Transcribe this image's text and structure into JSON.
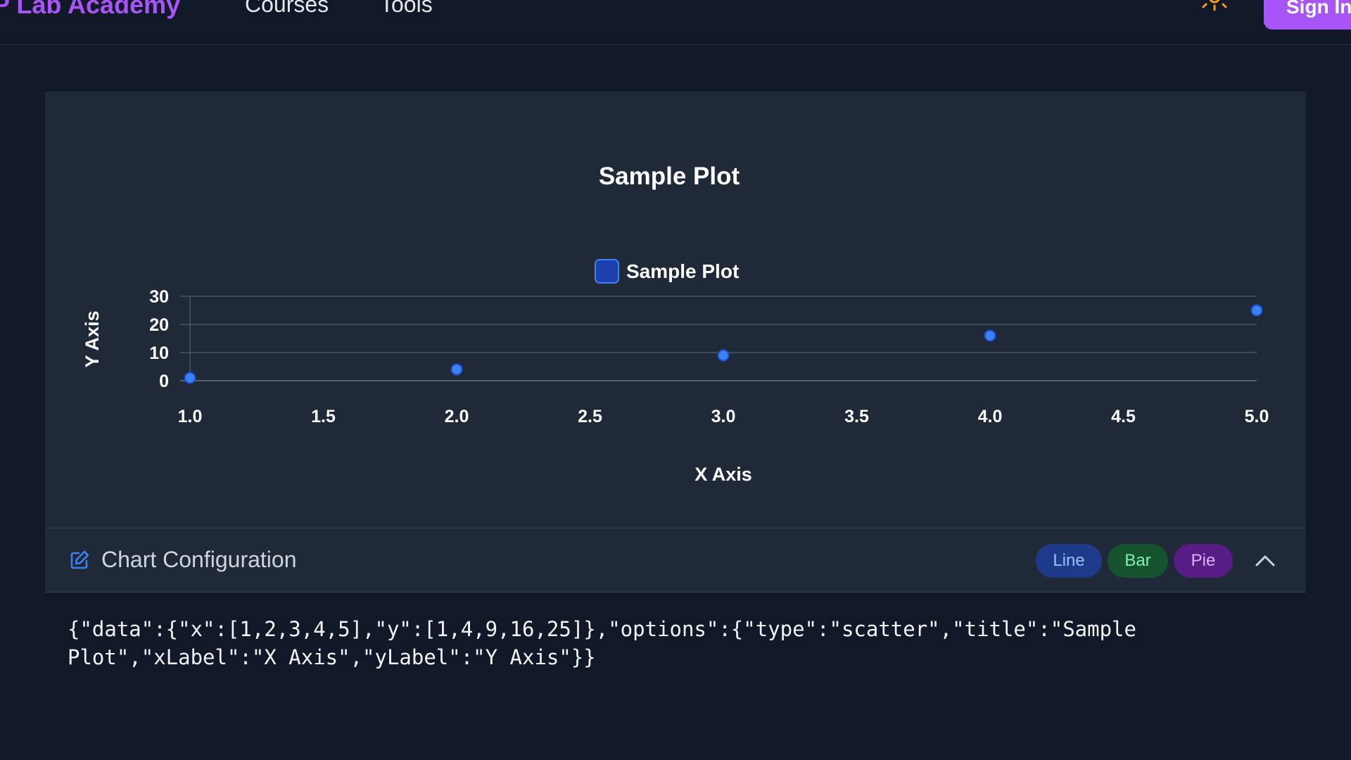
{
  "header": {
    "brand": "P Lab Academy",
    "nav": [
      {
        "label": "Courses"
      },
      {
        "label": "Tools"
      }
    ],
    "theme_icon": "sun-icon",
    "signin_label": "Sign In"
  },
  "chart_data": {
    "type": "scatter",
    "title": "Sample Plot",
    "xlabel": "X Axis",
    "ylabel": "Y Axis",
    "series": [
      {
        "name": "Sample Plot",
        "x": [
          1,
          2,
          3,
          4,
          5
        ],
        "y": [
          1,
          4,
          9,
          16,
          25
        ]
      }
    ],
    "xlim": [
      1.0,
      5.0
    ],
    "ylim": [
      0,
      30
    ],
    "xticks": [
      "1.0",
      "1.5",
      "2.0",
      "2.5",
      "3.0",
      "3.5",
      "4.0",
      "4.5",
      "5.0"
    ],
    "yticks": [
      "0",
      "10",
      "20",
      "30"
    ],
    "grid": true,
    "legend": "top-center",
    "colors": {
      "point": "#3b82f6",
      "point_stroke": "#1d4ed8"
    }
  },
  "config": {
    "title": "Chart Configuration",
    "icon": "edit-icon",
    "types": [
      {
        "label": "Line"
      },
      {
        "label": "Bar"
      },
      {
        "label": "Pie"
      }
    ],
    "collapse_icon": "chevron-up-icon",
    "json": "{\"data\":{\"x\":[1,2,3,4,5],\"y\":[1,4,9,16,25]},\"options\":{\"type\":\"scatter\",\"title\":\"Sample Plot\",\"xLabel\":\"X Axis\",\"yLabel\":\"Y Axis\"}}"
  },
  "colors": {
    "accent": "#a855f7",
    "background": "#111827",
    "panel": "#1f2937"
  }
}
